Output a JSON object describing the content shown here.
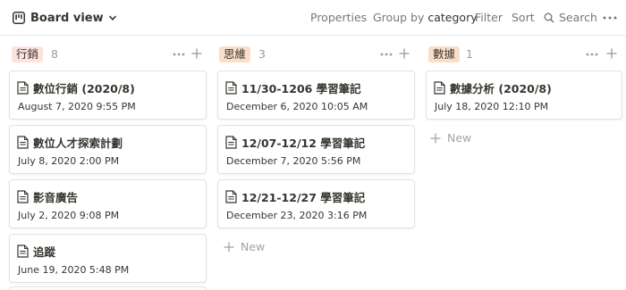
{
  "toolbar": {
    "view_label": "Board view",
    "properties_label": "Properties",
    "group_by_prefix": "Group by",
    "group_by_value": "category",
    "filter_label": "Filter",
    "sort_label": "Sort",
    "search_label": "Search"
  },
  "columns": [
    {
      "tag": "行銷",
      "tag_color": "#ffe2dd",
      "count": "8",
      "cards": [
        {
          "title": "數位行銷 (2020/8)",
          "date": "August 7, 2020 9:55 PM"
        },
        {
          "title": "數位人才探索計劃",
          "date": "July 8, 2020 2:00 PM"
        },
        {
          "title": "影音廣告",
          "date": "July 2, 2020 9:08 PM"
        },
        {
          "title": "追蹤",
          "date": "June 19, 2020 5:48 PM"
        }
      ]
    },
    {
      "tag": "思維",
      "tag_color": "#fadec9",
      "count": "3",
      "cards": [
        {
          "title": "11/30-1206 學習筆記",
          "date": "December 6, 2020 10:05 AM"
        },
        {
          "title": "12/07-12/12 學習筆記",
          "date": "December 7, 2020 5:56 PM"
        },
        {
          "title": "12/21-12/27 學習筆記",
          "date": "December 23, 2020 3:16 PM"
        }
      ],
      "new_label": "New"
    },
    {
      "tag": "數據",
      "tag_color": "#fadec9",
      "count": "1",
      "cards": [
        {
          "title": "數據分析 (2020/8)",
          "date": "July 18, 2020 12:10 PM"
        }
      ],
      "new_label": "New"
    }
  ]
}
